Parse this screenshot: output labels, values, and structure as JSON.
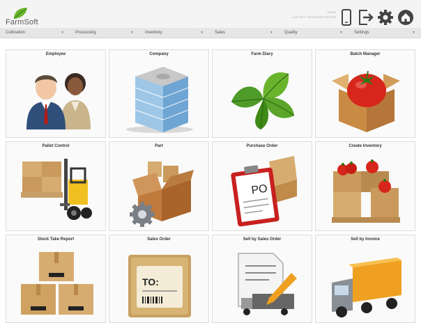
{
  "app": {
    "logo_text": "FarmSoft",
    "user_line1": "Admin",
    "user_line2": "Low-Tech, Registered FarmSoft"
  },
  "header_icons": [
    "mobile-phone-icon",
    "logout-icon",
    "settings-gear-icon",
    "home-icon"
  ],
  "nav": [
    {
      "label": "Cultivation"
    },
    {
      "label": "Processing"
    },
    {
      "label": "Inventory"
    },
    {
      "label": "Sales"
    },
    {
      "label": "Quality"
    },
    {
      "label": "Settings"
    }
  ],
  "tiles": [
    {
      "title": "Employee",
      "icon": "employee-people-icon"
    },
    {
      "title": "Company",
      "icon": "company-building-icon"
    },
    {
      "title": "Farm Diary",
      "icon": "basil-leaves-icon"
    },
    {
      "title": "Batch Manager",
      "icon": "tomato-box-icon"
    },
    {
      "title": "Pallet Control",
      "icon": "forklift-pallet-icon"
    },
    {
      "title": "Part",
      "icon": "parts-box-gear-icon"
    },
    {
      "title": "Purchase Order",
      "icon": "purchase-order-clipboard-icon",
      "badge": "PO"
    },
    {
      "title": "Create Inventory",
      "icon": "inventory-crates-icon"
    },
    {
      "title": "Stock Take Report",
      "icon": "stacked-boxes-icon"
    },
    {
      "title": "Sales Order",
      "icon": "shipping-label-icon",
      "badge": "TO:"
    },
    {
      "title": "Sell by Sales Order",
      "icon": "document-truck-icon"
    },
    {
      "title": "Sell by Invoice",
      "icon": "delivery-truck-icon"
    }
  ],
  "colors": {
    "leaf_green": "#6ab42d",
    "header_bg": "#f4f4f4",
    "nav_bg": "#e6e6e6",
    "icon_dark": "#444444"
  }
}
